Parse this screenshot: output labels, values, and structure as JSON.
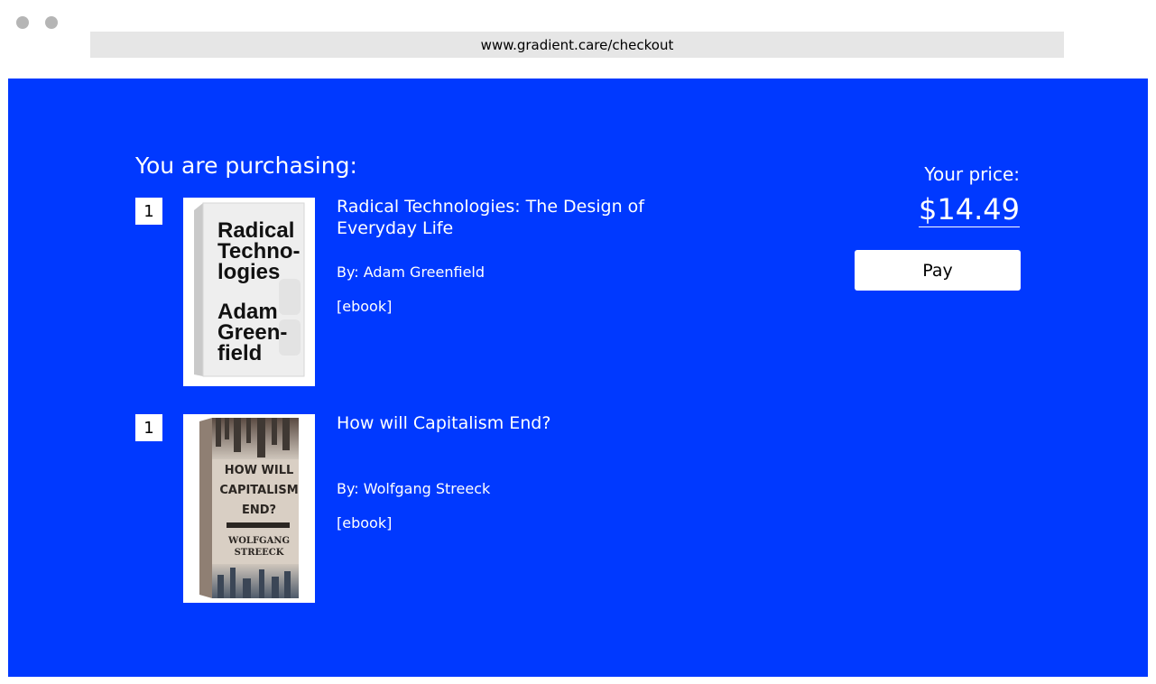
{
  "browser": {
    "url": "www.gradient.care/checkout"
  },
  "checkout": {
    "heading": "You are purchasing:",
    "price_label": "Your price:",
    "price": "$14.49",
    "pay_label": "Pay",
    "accent_color": "#0039ff",
    "items": [
      {
        "quantity": "1",
        "title": "Radical Technologies: The Design of Everyday Life",
        "author": "By: Adam Greenfield",
        "format": "[ebook]",
        "cover_text": [
          "Radical",
          "Techno-",
          "logies",
          "Adam",
          "Green-",
          "field"
        ]
      },
      {
        "quantity": "1",
        "title": "How will Capitalism End?",
        "author": "By: Wolfgang Streeck",
        "format": "[ebook]",
        "cover_text": [
          "HOW WILL",
          "CAPITALISM",
          "END?",
          "WOLFGANG",
          "STREECK"
        ]
      }
    ]
  }
}
